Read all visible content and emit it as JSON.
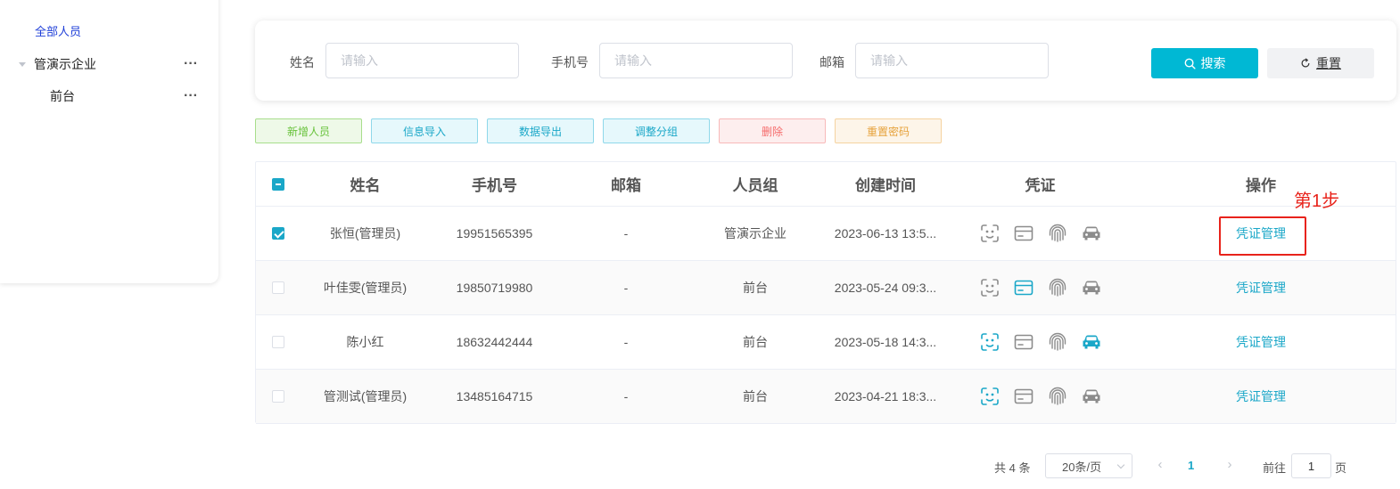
{
  "colors": {
    "accent": "#1aa7c8",
    "primary_button": "#00b8d4",
    "annotation": "#e8231b",
    "icon_inactive": "#8c8c8c"
  },
  "sidebar": {
    "all_label": "全部人员",
    "enterprise_label": "管演示企业",
    "front_desk_label": "前台",
    "more": "···"
  },
  "search": {
    "name_label": "姓名",
    "phone_label": "手机号",
    "email_label": "邮箱",
    "placeholder": "请输入",
    "search_button": "搜索",
    "reset_button": "重置"
  },
  "actions": {
    "add": "新增人员",
    "import": "信息导入",
    "export": "数据导出",
    "regroup": "调整分组",
    "delete": "删除",
    "reset_password": "重置密码"
  },
  "table": {
    "columns": [
      "姓名",
      "手机号",
      "邮箱",
      "人员组",
      "创建时间",
      "凭证",
      "操作"
    ],
    "operation_label": "凭证管理",
    "rows": [
      {
        "name": "张恒(管理员)",
        "phone": "19951565395",
        "email": "-",
        "group": "管演示企业",
        "created": "2023-06-13 13:5...",
        "checked": true,
        "creds": {
          "face": false,
          "card": false,
          "fingerprint": false,
          "car": false
        }
      },
      {
        "name": "叶佳雯(管理员)",
        "phone": "19850719980",
        "email": "-",
        "group": "前台",
        "created": "2023-05-24 09:3...",
        "checked": false,
        "creds": {
          "face": false,
          "card": true,
          "fingerprint": false,
          "car": false
        }
      },
      {
        "name": "陈小红",
        "phone": "18632442444",
        "email": "-",
        "group": "前台",
        "created": "2023-05-18 14:3...",
        "checked": false,
        "creds": {
          "face": true,
          "card": false,
          "fingerprint": false,
          "car": true
        }
      },
      {
        "name": "管测试(管理员)",
        "phone": "13485164715",
        "email": "-",
        "group": "前台",
        "created": "2023-04-21 18:3...",
        "checked": false,
        "creds": {
          "face": true,
          "card": false,
          "fingerprint": false,
          "car": false
        }
      }
    ]
  },
  "annotation": {
    "step_label": "第1步"
  },
  "pagination": {
    "total": "共 4 条",
    "page_size": "20条/页",
    "current_page": "1",
    "goto_label": "前往",
    "goto_value": "1",
    "page_unit": "页",
    "prev": "‹",
    "next": "›"
  }
}
